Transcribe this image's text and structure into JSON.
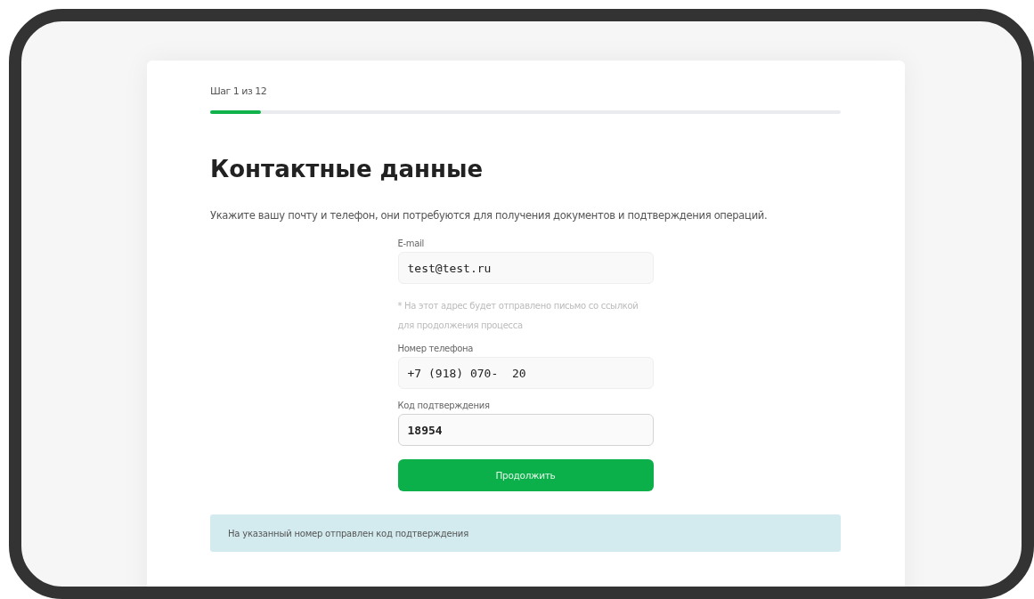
{
  "progress": {
    "label": "Шаг 1 из 12",
    "level": 0.08
  },
  "heading": "Контактные данные",
  "description": "Укажите вашу почту и телефон, они потребуются для получения документов и подтверждения операций.",
  "fields": [
    {
      "label": "E-mail",
      "value": "test@test.ru",
      "focused": false,
      "hint": "* На этот адрес будет отправлено письмо со ссылкой для продолжения процесса"
    },
    {
      "label": "Номер телефона",
      "value": "+7 (918) 070-  20",
      "focused": false
    },
    {
      "label": "Код подтверждения",
      "value": "18954",
      "focused": true
    }
  ],
  "submit_button": "Продолжить",
  "alert": {
    "kind": "info",
    "text": "На указанный номер отправлен код подтверждения"
  }
}
